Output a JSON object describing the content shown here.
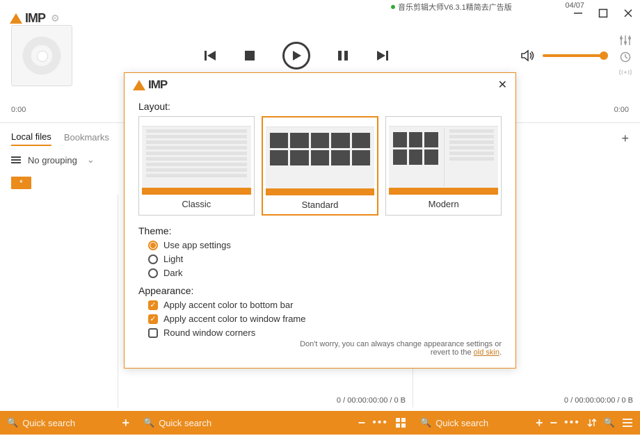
{
  "bg_tab": "音乐剪辑大师V6.3.1精简去广告版",
  "bg_date": "04/07",
  "app_name": "IMP",
  "time_left": "0:00",
  "time_right": "0:00",
  "tabs": {
    "local": "Local files",
    "bookmarks": "Bookmarks"
  },
  "grouping": "No grouping",
  "chip_all": "*",
  "playlist_stats_mid": "0 / 00:00:00:00 / 0 B",
  "playlist_stats_right": "0 / 00:00:00:00 / 0 B",
  "quick_search": "Quick search",
  "dialog": {
    "layout_label": "Layout:",
    "layouts": {
      "classic": "Classic",
      "standard": "Standard",
      "modern": "Modern"
    },
    "theme_label": "Theme:",
    "theme": {
      "app": "Use app settings",
      "light": "Light",
      "dark": "Dark"
    },
    "appearance_label": "Appearance:",
    "appearance": {
      "accent_bottom": "Apply accent color to bottom bar",
      "accent_frame": "Apply accent color to window frame",
      "round_corners": "Round window corners"
    },
    "hint_pre": "Don't worry, you can always change appearance settings or revert to the ",
    "hint_link": "old skin",
    "hint_post": "."
  },
  "colors": {
    "accent": "#ea8b1c"
  }
}
